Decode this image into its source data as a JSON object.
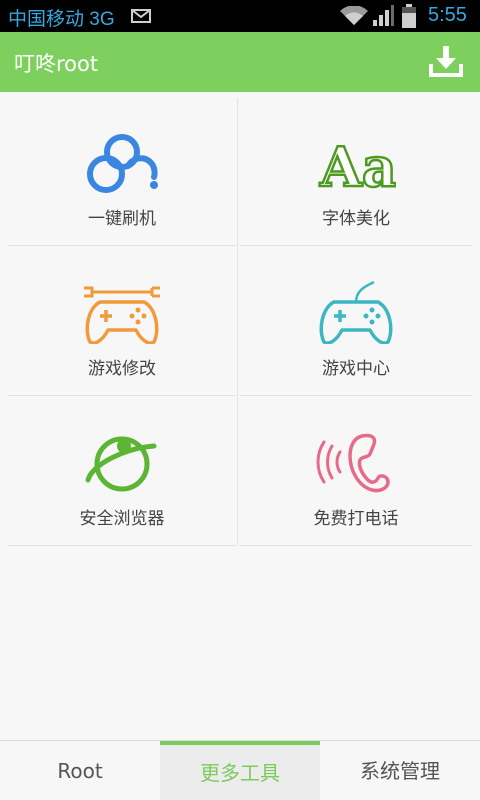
{
  "status_bar": {
    "carrier": "中国移动 3G",
    "time": "5:55",
    "icons": [
      "mail-icon",
      "wifi-icon",
      "signal-icon",
      "battery-icon"
    ]
  },
  "app_bar": {
    "title": "叮咚root",
    "action_icon": "download-icon"
  },
  "tools": [
    {
      "label": "一键刷机",
      "icon": "baidu-flash-icon",
      "color": "#3b86e0"
    },
    {
      "label": "字体美化",
      "icon": "font-aa-icon",
      "color": "#4c9a1f"
    },
    {
      "label": "游戏修改",
      "icon": "gamepad-wrench-icon",
      "color": "#f09a3a"
    },
    {
      "label": "游戏中心",
      "icon": "gamepad-icon",
      "color": "#3bb7c4"
    },
    {
      "label": "安全浏览器",
      "icon": "browser-globe-icon",
      "color": "#5cb533"
    },
    {
      "label": "免费打电话",
      "icon": "phone-call-icon",
      "color": "#e86a8a"
    }
  ],
  "tabs": [
    {
      "label": "Root",
      "active": false
    },
    {
      "label": "更多工具",
      "active": true
    },
    {
      "label": "系统管理",
      "active": false
    }
  ],
  "colors": {
    "accent": "#7ed05e",
    "status_text": "#35a9de"
  }
}
